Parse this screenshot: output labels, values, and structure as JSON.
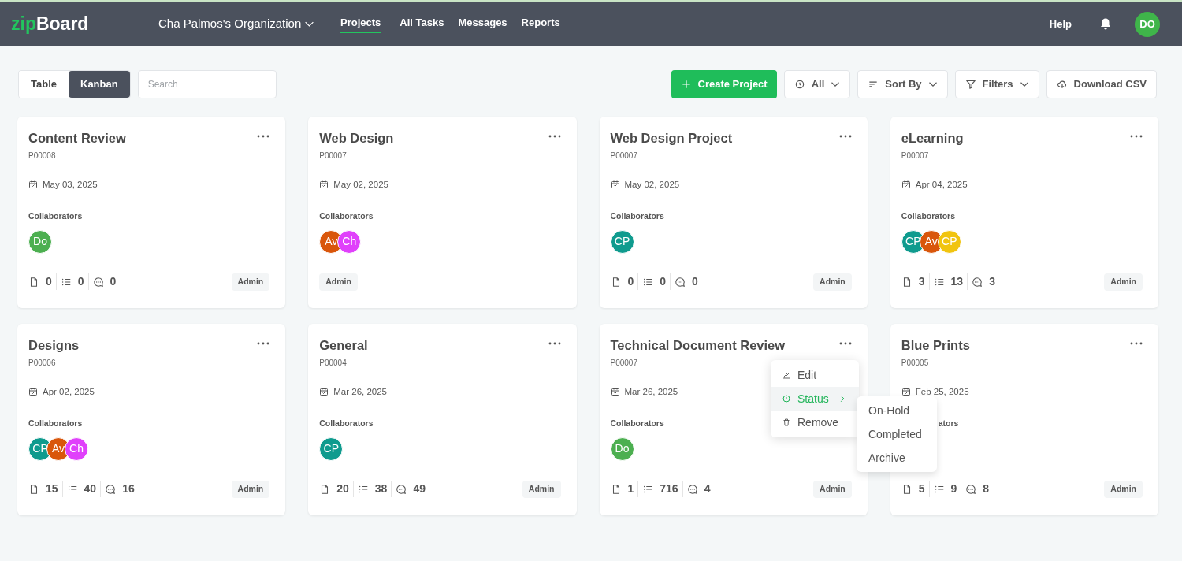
{
  "header": {
    "logo_accent": "zip",
    "logo_rest": "Board",
    "organization": "Cha Palmos's Organization",
    "nav": [
      {
        "label": "Projects",
        "selected": true
      },
      {
        "label": "All Tasks",
        "selected": false
      },
      {
        "label": "Messages",
        "selected": false
      },
      {
        "label": "Reports",
        "selected": false
      }
    ],
    "help": "Help",
    "user_initials": "DO"
  },
  "view_tabs": [
    {
      "label": "Table",
      "selected": false
    },
    {
      "label": "Kanban",
      "selected": true
    }
  ],
  "search": {
    "placeholder": "Search"
  },
  "actions": [
    {
      "kind": "create",
      "label": "Create Project"
    },
    {
      "kind": "status",
      "label": "All"
    },
    {
      "kind": "sort",
      "label": "Sort By"
    },
    {
      "kind": "filter",
      "label": "Filters"
    },
    {
      "kind": "download",
      "label": "Download CSV"
    }
  ],
  "cards": [
    {
      "title": "Content Review",
      "id": "P00008",
      "date": "May 03, 2025",
      "collaborators_label": "Collaborators",
      "collaborators": [
        {
          "initials": "Do",
          "color": "#4caf50"
        }
      ],
      "stats": {
        "files": "0",
        "tasks": "0",
        "comments": "0"
      },
      "role": "Admin"
    },
    {
      "title": "Web Design",
      "id": "P00007",
      "date": "May 02, 2025",
      "collaborators_label": "Collaborators",
      "collaborators": [
        {
          "initials": "Av",
          "color": "#d9560b"
        },
        {
          "initials": "Ch",
          "color": "#e040fb"
        }
      ],
      "role": "Admin"
    },
    {
      "title": "Web Design Project",
      "id": "P00007",
      "date": "May 02, 2025",
      "collaborators_label": "Collaborators",
      "collaborators": [
        {
          "initials": "CP",
          "color": "#0f9b8e"
        }
      ],
      "stats": {
        "files": "0",
        "tasks": "0",
        "comments": "0"
      },
      "role": "Admin"
    },
    {
      "title": "eLearning",
      "id": "P00007",
      "date": "Apr 04, 2025",
      "collaborators_label": "Collaborators",
      "collaborators": [
        {
          "initials": "CP",
          "color": "#0f9b8e"
        },
        {
          "initials": "Av",
          "color": "#d9560b"
        },
        {
          "initials": "CP",
          "color": "#f1c40f"
        }
      ],
      "stats": {
        "files": "3",
        "tasks": "13",
        "comments": "3"
      },
      "role": "Admin"
    },
    {
      "title": "Designs",
      "id": "P00006",
      "date": "Apr 02, 2025",
      "collaborators_label": "Collaborators",
      "collaborators": [
        {
          "initials": "CP",
          "color": "#0f9b8e"
        },
        {
          "initials": "Av",
          "color": "#d9560b"
        },
        {
          "initials": "Ch",
          "color": "#e040fb"
        }
      ],
      "stats": {
        "files": "15",
        "tasks": "40",
        "comments": "16"
      },
      "role": "Admin"
    },
    {
      "title": "General",
      "id": "P00004",
      "date": "Mar 26, 2025",
      "collaborators_label": "Collaborators",
      "collaborators": [
        {
          "initials": "CP",
          "color": "#0f9b8e"
        }
      ],
      "stats": {
        "files": "20",
        "tasks": "38",
        "comments": "49"
      },
      "role": "Admin"
    },
    {
      "title": "Technical Document Review",
      "id": "P00007",
      "date": "Mar 26, 2025",
      "collaborators_label": "Collaborators",
      "collaborators": [
        {
          "initials": "Do",
          "color": "#4caf50"
        }
      ],
      "stats": {
        "files": "1",
        "tasks": "716",
        "comments": "4"
      },
      "role": "Admin",
      "menu": {
        "items": [
          {
            "kind": "edit",
            "label": "Edit",
            "selected": false
          },
          {
            "kind": "status",
            "label": "Status",
            "selected": true,
            "submenu": [
              "On-Hold",
              "Completed",
              "Archive"
            ]
          },
          {
            "kind": "remove",
            "label": "Remove",
            "selected": false
          }
        ]
      }
    },
    {
      "title": "Blue Prints",
      "id": "P00005",
      "date": "Feb 25, 2025",
      "collaborators_label": "ators",
      "label_partly_hidden": true,
      "stats": {
        "files": "5",
        "tasks": "9",
        "comments": "8"
      },
      "role": "Admin"
    }
  ]
}
